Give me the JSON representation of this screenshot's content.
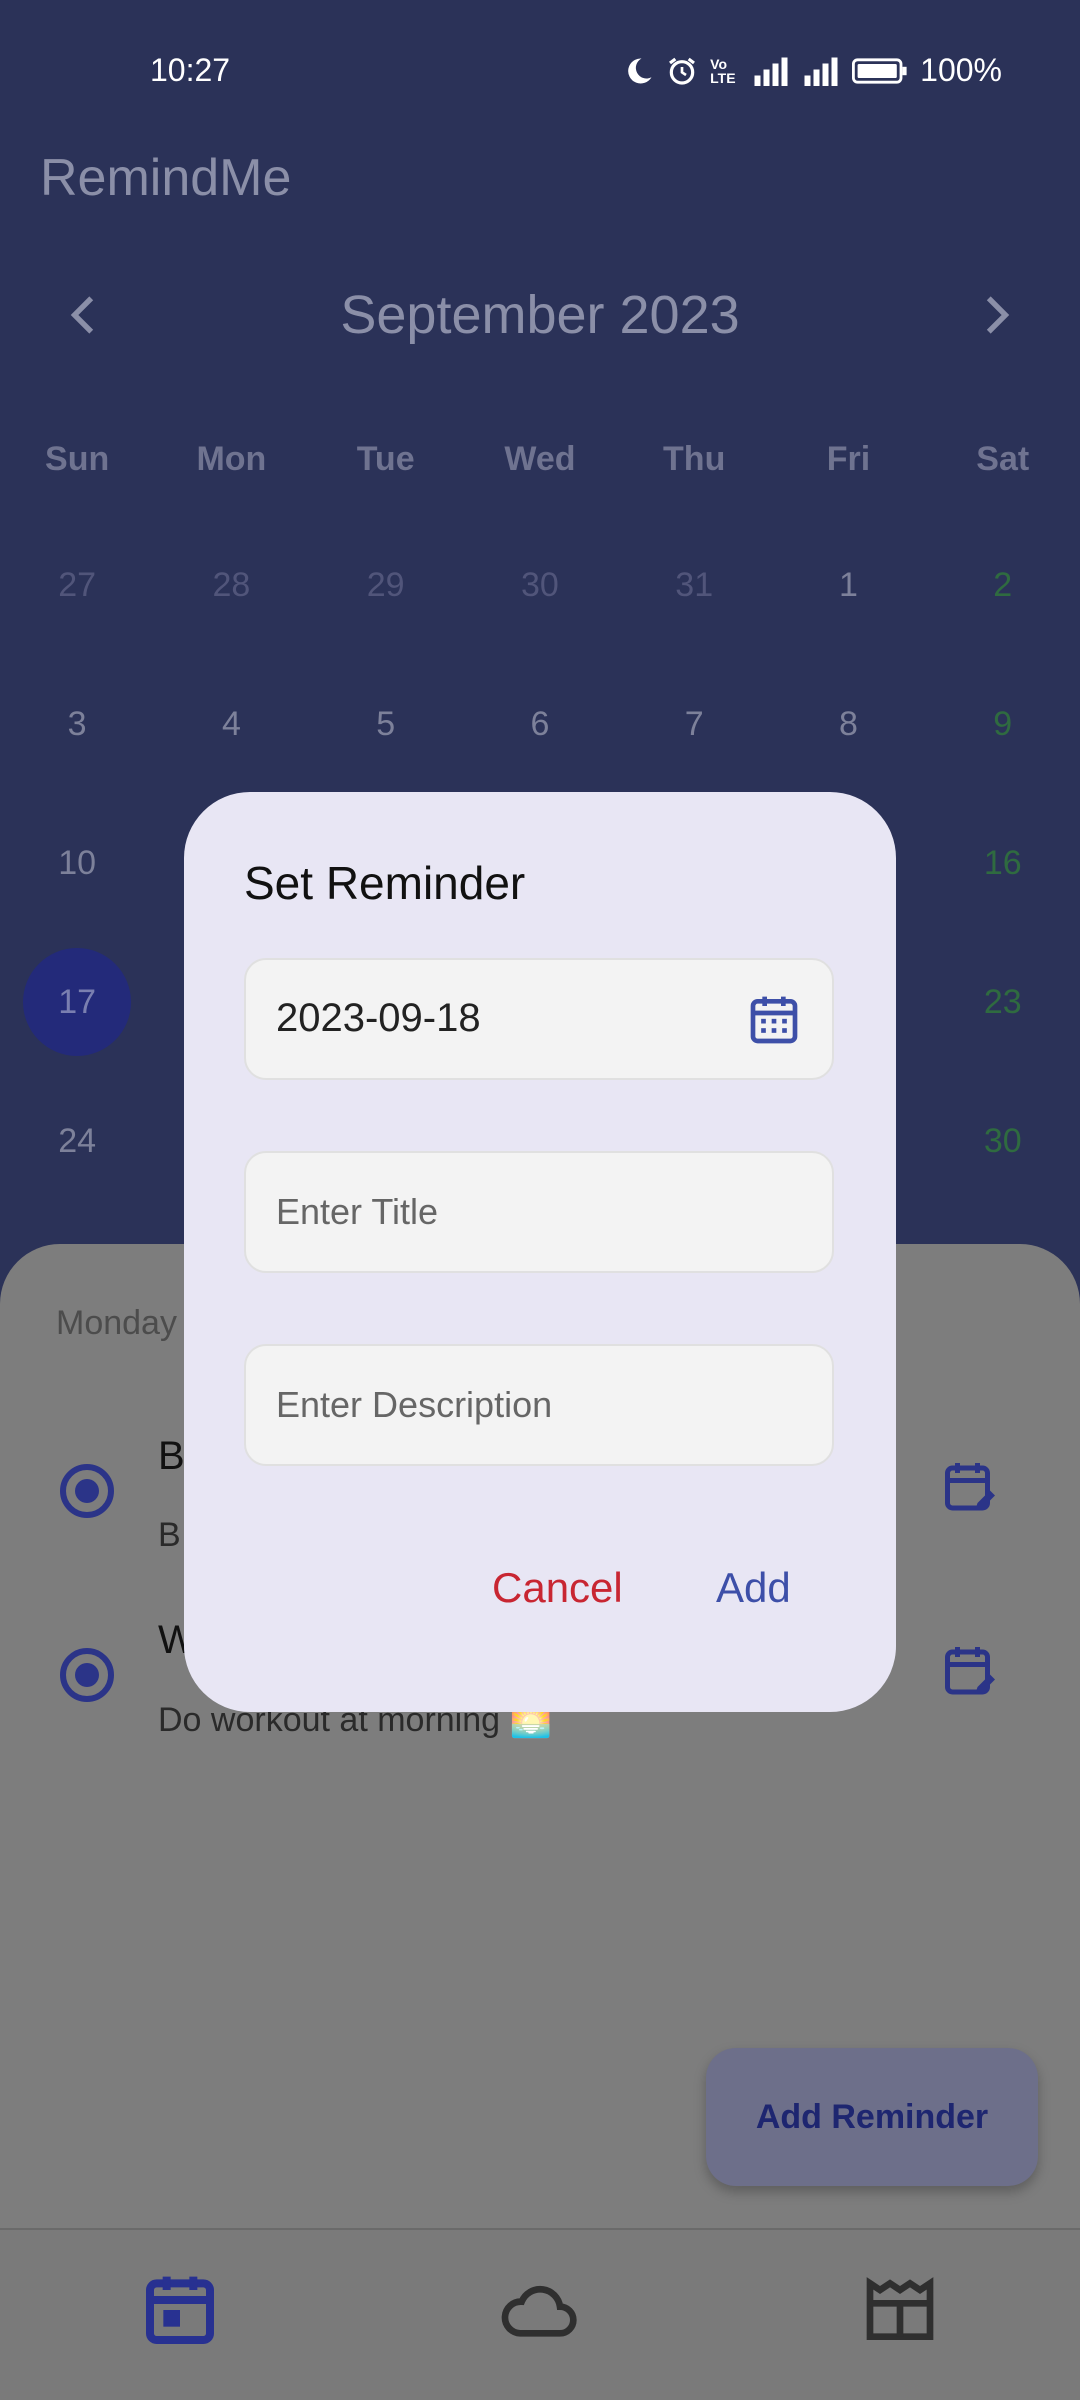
{
  "status_bar": {
    "time": "10:27",
    "battery": "100%",
    "volte": "Vo LTE"
  },
  "app": {
    "title": "RemindMe"
  },
  "calendar": {
    "month_label": "September 2023",
    "weekdays": [
      "Sun",
      "Mon",
      "Tue",
      "Wed",
      "Thu",
      "Fri",
      "Sat"
    ],
    "rows": [
      [
        "27",
        "28",
        "29",
        "30",
        "31",
        "1",
        "2"
      ],
      [
        "3",
        "4",
        "5",
        "6",
        "7",
        "8",
        "9"
      ],
      [
        "10",
        "",
        "",
        "",
        "",
        "",
        "16"
      ],
      [
        "17",
        "",
        "",
        "",
        "",
        "",
        "23"
      ],
      [
        "24",
        "",
        "",
        "",
        "",
        "",
        "30"
      ]
    ],
    "selected_day": "17"
  },
  "sheet": {
    "date_label": "Monday",
    "reminders": [
      {
        "title": "B",
        "description": "B"
      },
      {
        "title": "W",
        "description": "Do workout at morning 🌅"
      }
    ]
  },
  "fab": {
    "label": "Add Reminder"
  },
  "dialog": {
    "title": "Set Reminder",
    "date_value": "2023-09-18",
    "title_placeholder": "Enter Title",
    "description_placeholder": "Enter Description",
    "cancel_label": "Cancel",
    "add_label": "Add"
  },
  "colors": {
    "primary": "#3d4fa8",
    "cancel": "#c82632",
    "header_bg": "#2b3258",
    "dialog_bg": "#e8e6f4"
  },
  "icons": {
    "date_field": "calendar-icon",
    "reminder_action": "calendar-edit-icon",
    "nav": [
      "calendar-icon",
      "cloud-icon",
      "newspaper-icon"
    ]
  }
}
